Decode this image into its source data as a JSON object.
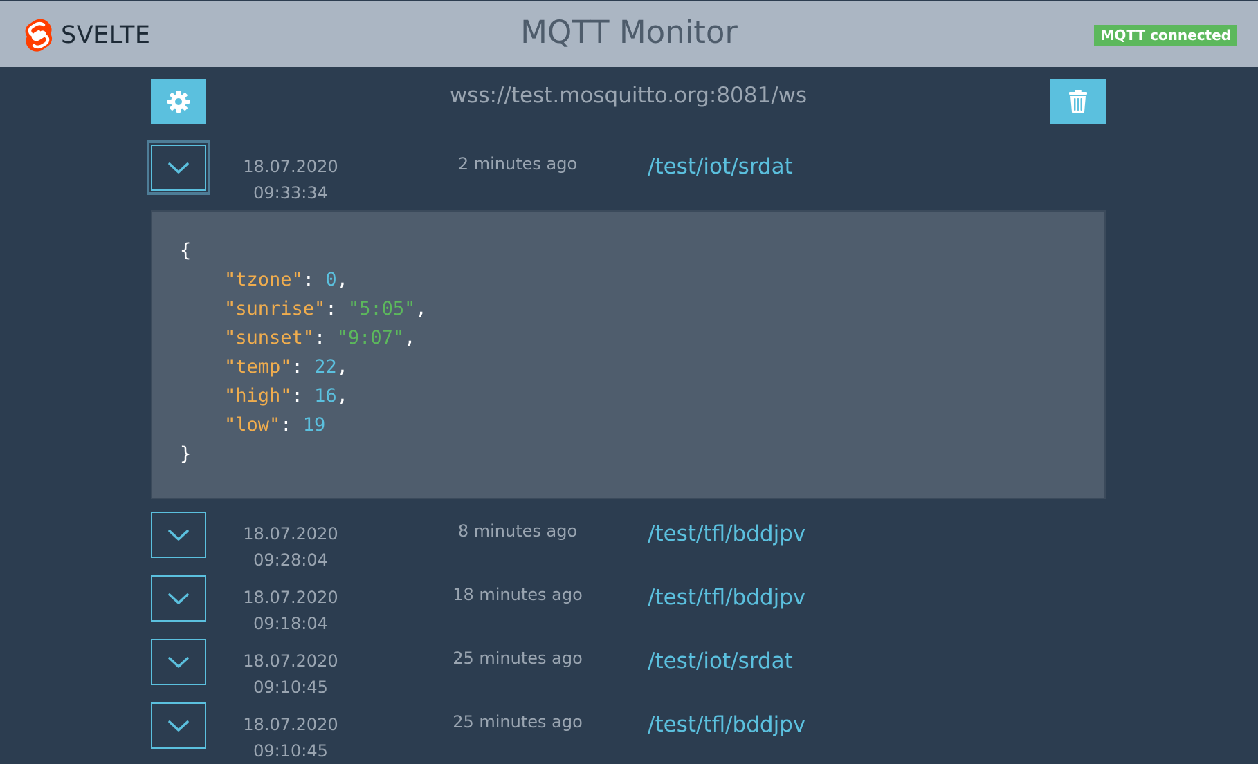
{
  "header": {
    "logo_text": "SVELTE",
    "title": "MQTT Monitor",
    "status": "MQTT connected"
  },
  "toolbar": {
    "broker_url": "wss://test.mosquitto.org:8081/ws"
  },
  "messages": [
    {
      "date": "18.07.2020",
      "time": "09:33:34",
      "ago": "2 minutes ago",
      "topic": "/test/iot/srdat",
      "expanded": true
    },
    {
      "date": "18.07.2020",
      "time": "09:28:04",
      "ago": "8 minutes ago",
      "topic": "/test/tfl/bddjpv",
      "expanded": false
    },
    {
      "date": "18.07.2020",
      "time": "09:18:04",
      "ago": "18 minutes ago",
      "topic": "/test/tfl/bddjpv",
      "expanded": false
    },
    {
      "date": "18.07.2020",
      "time": "09:10:45",
      "ago": "25 minutes ago",
      "topic": "/test/iot/srdat",
      "expanded": false
    },
    {
      "date": "18.07.2020",
      "time": "09:10:45",
      "ago": "25 minutes ago",
      "topic": "/test/tfl/bddjpv",
      "expanded": false
    }
  ],
  "payload": {
    "open_brace": "{",
    "close_brace": "}",
    "fields": [
      {
        "key": "\"tzone\"",
        "value": "0",
        "type": "number",
        "sep": ","
      },
      {
        "key": "\"sunrise\"",
        "value": "\"5:05\"",
        "type": "string",
        "sep": ","
      },
      {
        "key": "\"sunset\"",
        "value": "\"9:07\"",
        "type": "string",
        "sep": ","
      },
      {
        "key": "\"temp\"",
        "value": "22",
        "type": "number",
        "sep": ","
      },
      {
        "key": "\"high\"",
        "value": "16",
        "type": "number",
        "sep": ","
      },
      {
        "key": "\"low\"",
        "value": "19",
        "type": "number",
        "sep": ""
      }
    ]
  },
  "colors": {
    "background": "#2c3d50",
    "header": "#abb6c3",
    "accent": "#5bc0de",
    "success": "#5cb85c",
    "json_key": "#f0ad4e",
    "payload_bg": "#4f5d6d"
  },
  "icons": {
    "logo": "svelte-logo-icon",
    "settings": "gear-icon",
    "clear": "trash-icon",
    "toggle": "chevron-down-icon"
  }
}
